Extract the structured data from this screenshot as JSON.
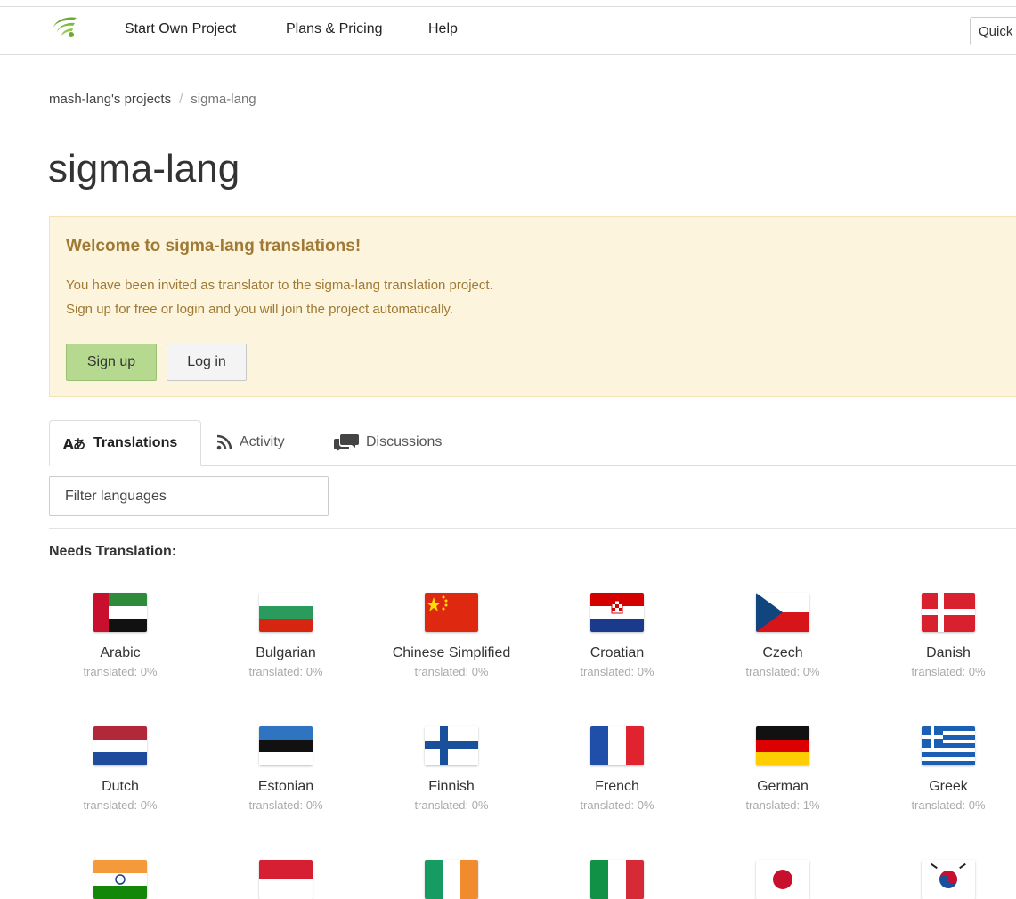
{
  "nav": {
    "start_project": "Start Own Project",
    "plans_pricing": "Plans & Pricing",
    "help": "Help",
    "quick_placeholder": "Quick"
  },
  "breadcrumb": {
    "parent": "mash-lang's projects",
    "separator": "/",
    "current": "sigma-lang"
  },
  "page_title": "sigma-lang",
  "welcome": {
    "title": "Welcome to sigma-lang translations!",
    "line1": "You have been invited as translator to the sigma-lang translation project.",
    "line2": "Sign up for free or login and you will join the project automatically.",
    "signup_label": "Sign up",
    "login_label": "Log in"
  },
  "tabs": {
    "translations": "Translations",
    "activity": "Activity",
    "discussions": "Discussions"
  },
  "filter_placeholder": "Filter languages",
  "section_label": "Needs Translation:",
  "languages": [
    {
      "name": "Arabic",
      "progress": "translated: 0%",
      "flag": "ae"
    },
    {
      "name": "Bulgarian",
      "progress": "translated: 0%",
      "flag": "bg"
    },
    {
      "name": "Chinese Simplified",
      "progress": "translated: 0%",
      "flag": "cn"
    },
    {
      "name": "Croatian",
      "progress": "translated: 0%",
      "flag": "hr"
    },
    {
      "name": "Czech",
      "progress": "translated: 0%",
      "flag": "cz"
    },
    {
      "name": "Danish",
      "progress": "translated: 0%",
      "flag": "dk"
    },
    {
      "name": "Dutch",
      "progress": "translated: 0%",
      "flag": "nl"
    },
    {
      "name": "Estonian",
      "progress": "translated: 0%",
      "flag": "ee"
    },
    {
      "name": "Finnish",
      "progress": "translated: 0%",
      "flag": "fi"
    },
    {
      "name": "French",
      "progress": "translated: 0%",
      "flag": "fr"
    },
    {
      "name": "German",
      "progress": "translated: 1%",
      "flag": "de"
    },
    {
      "name": "Greek",
      "progress": "translated: 0%",
      "flag": "gr"
    },
    {
      "flag": "in"
    },
    {
      "flag": "id"
    },
    {
      "flag": "ie"
    },
    {
      "flag": "it"
    },
    {
      "flag": "jp"
    },
    {
      "flag": "kr"
    }
  ],
  "colors": {
    "welcome_bg": "#fcf4dd",
    "welcome_text": "#a07a35",
    "signup_bg": "#b5d98f",
    "logo_green": "#6cab2f"
  },
  "icons": {
    "logo": "crowdin-logo-icon",
    "translations": "translate-icon",
    "activity": "rss-icon",
    "discussions": "chat-bubbles-icon"
  }
}
